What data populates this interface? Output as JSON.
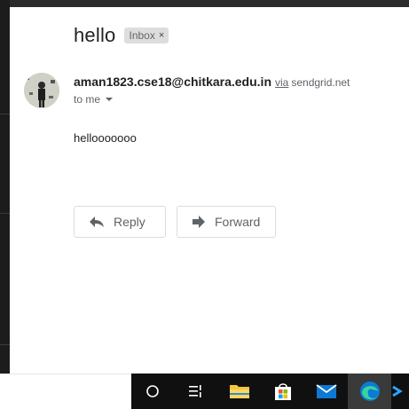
{
  "email": {
    "subject": "hello",
    "label": "Inbox",
    "label_remove": "×",
    "sender": "aman1823.cse18@chitkara.edu.in",
    "via_word": "via",
    "via_domain": "sendgrid.net",
    "recipient": "to me",
    "body": "hellooooooo"
  },
  "actions": {
    "reply_label": "Reply",
    "forward_label": "Forward"
  },
  "taskbar": {
    "items": [
      "search-icon",
      "task-view-icon",
      "file-explorer-icon",
      "store-icon",
      "mail-icon",
      "edge-icon",
      "powershell-icon"
    ],
    "active": "edge-icon"
  },
  "colors": {
    "edge_blue": "#0c7bd6",
    "folder_yellow": "#f5c542",
    "mail_blue": "#0f78d4"
  }
}
